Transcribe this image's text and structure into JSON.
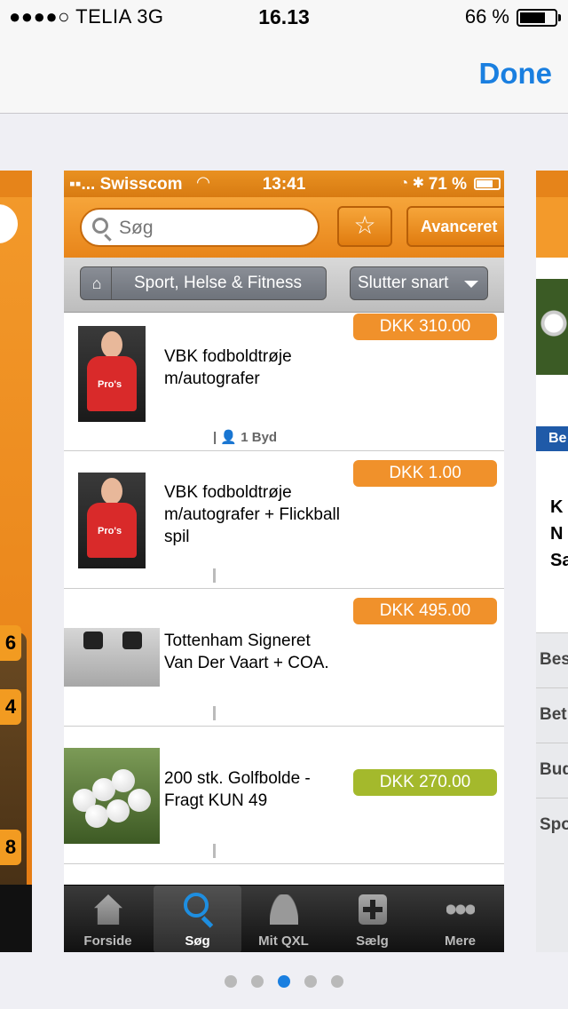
{
  "os_status": {
    "carrier": "●●●●○ TELIA   3G",
    "time": "16.13",
    "battery": "66 %"
  },
  "switcher": {
    "done_label": "Done"
  },
  "app": {
    "status": {
      "carrier": "▪▪... Swisscom",
      "time": "13:41",
      "battery": "71 %"
    },
    "search": {
      "placeholder": "Søg",
      "advanced_label": "Avanceret"
    },
    "breadcrumb": {
      "category": "Sport, Helse & Fitness",
      "sort_label": "Slutter snart"
    },
    "listings": [
      {
        "title": "VBK fodboldtrøje m/autografer",
        "price": "DKK 310.00",
        "price_color": "#f0912b",
        "bids": "1",
        "bid_label": "Byd"
      },
      {
        "title": "VBK fodboldtrøje m/autografer + Flickball spil",
        "price": "DKK 1.00",
        "price_color": "#f0912b"
      },
      {
        "title": "Tottenham Signeret Van Der Vaart + COA.",
        "price": "DKK 495.00",
        "price_color": "#f0912b"
      },
      {
        "title": "200 stk. Golfbolde - Fragt KUN 49",
        "price": "DKK 270.00",
        "price_color": "#a4b92c"
      }
    ],
    "tabs": [
      {
        "label": "Forside",
        "icon": "home-icon"
      },
      {
        "label": "Søg",
        "icon": "search-icon"
      },
      {
        "label": "Mit QXL",
        "icon": "user-icon"
      },
      {
        "label": "Sælg",
        "icon": "plus-icon"
      },
      {
        "label": "Mere",
        "icon": "more-icon"
      }
    ]
  },
  "left_card": {
    "badges": [
      "6",
      "4",
      "8"
    ]
  },
  "right_card": {
    "section_label": "Be",
    "text_lines": [
      "K",
      "N",
      "Sa"
    ],
    "menu": [
      "Bes",
      "Bet",
      "Bud",
      "Spo"
    ]
  },
  "page_dots": {
    "count": 5,
    "active_index": 2
  }
}
